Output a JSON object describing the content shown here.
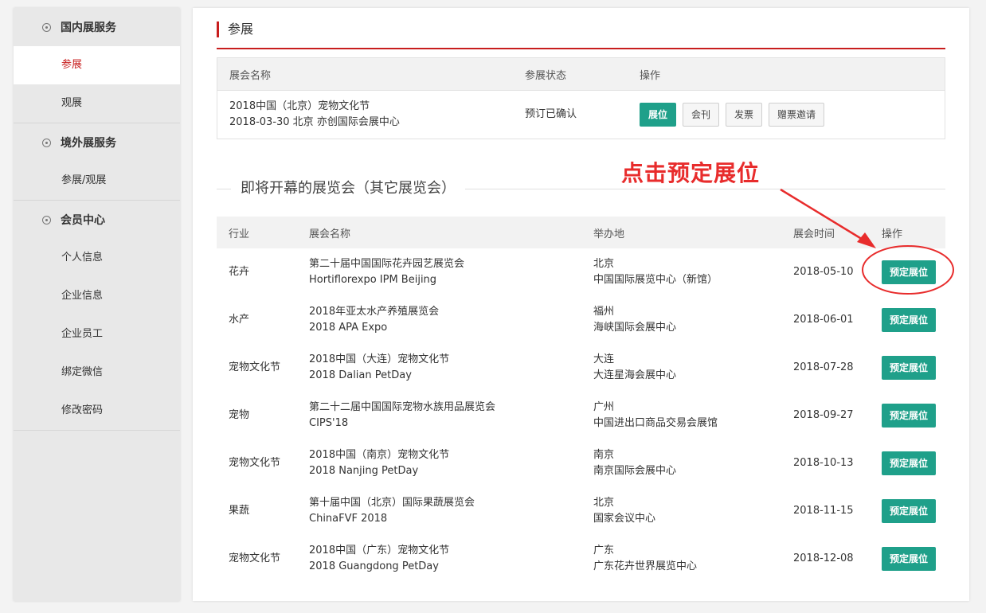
{
  "sidebar": {
    "sections": [
      {
        "title": "国内展服务",
        "items": [
          {
            "label": "参展",
            "active": true
          },
          {
            "label": "观展",
            "active": false
          }
        ]
      },
      {
        "title": "境外展服务",
        "items": [
          {
            "label": "参展/观展",
            "active": false
          }
        ]
      },
      {
        "title": "会员中心",
        "items": [
          {
            "label": "个人信息"
          },
          {
            "label": "企业信息"
          },
          {
            "label": "企业员工"
          },
          {
            "label": "绑定微信"
          },
          {
            "label": "修改密码"
          }
        ]
      }
    ]
  },
  "main": {
    "section_title": "参展",
    "my_exhibits": {
      "headers": [
        "展会名称",
        "参展状态",
        "操作"
      ],
      "rows": [
        {
          "name": "2018中国（北京）宠物文化节",
          "date_location": "2018-03-30  北京  亦创国际会展中心",
          "status": "预订已确认",
          "actions": [
            "展位",
            "会刊",
            "发票",
            "赠票邀请"
          ]
        }
      ]
    },
    "upcoming": {
      "title": "即将开幕的展览会（其它展览会）",
      "headers": [
        "行业",
        "展会名称",
        "举办地",
        "展会时间",
        "操作"
      ],
      "book_label": "预定展位",
      "rows": [
        {
          "industry": "花卉",
          "name_cn": "第二十届中国国际花卉园艺展览会",
          "name_en": "Hortiflorexpo IPM Beijing",
          "city": "北京",
          "venue": "中国国际展览中心（新馆）",
          "date": "2018-05-10"
        },
        {
          "industry": "水产",
          "name_cn": "2018年亚太水产养殖展览会",
          "name_en": "2018 APA Expo",
          "city": "福州",
          "venue": "海峡国际会展中心",
          "date": "2018-06-01"
        },
        {
          "industry": "宠物文化节",
          "name_cn": "2018中国（大连）宠物文化节",
          "name_en": "2018 Dalian PetDay",
          "city": "大连",
          "venue": "大连星海会展中心",
          "date": "2018-07-28"
        },
        {
          "industry": "宠物",
          "name_cn": "第二十二届中国国际宠物水族用品展览会",
          "name_en": "CIPS'18",
          "city": "广州",
          "venue": "中国进出口商品交易会展馆",
          "date": "2018-09-27"
        },
        {
          "industry": "宠物文化节",
          "name_cn": "2018中国（南京）宠物文化节",
          "name_en": "2018 Nanjing PetDay",
          "city": "南京",
          "venue": "南京国际会展中心",
          "date": "2018-10-13"
        },
        {
          "industry": "果蔬",
          "name_cn": "第十届中国（北京）国际果蔬展览会",
          "name_en": "ChinaFVF 2018",
          "city": "北京",
          "venue": "国家会议中心",
          "date": "2018-11-15"
        },
        {
          "industry": "宠物文化节",
          "name_cn": "2018中国（广东）宠物文化节",
          "name_en": "2018 Guangdong PetDay",
          "city": "广东",
          "venue": "广东花卉世界展览中心",
          "date": "2018-12-08"
        }
      ]
    }
  },
  "annotation": {
    "text": "点击预定展位",
    "color": "#e82c2c"
  },
  "colors": {
    "accent_red": "#c81e1e",
    "button_teal": "#1fa08a"
  }
}
